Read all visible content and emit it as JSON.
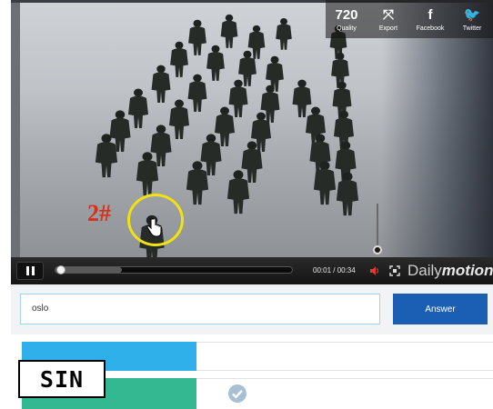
{
  "player": {
    "share": [
      {
        "glyph": "720",
        "label": "Quality",
        "icon": "quality-icon"
      },
      {
        "glyph": "⤧",
        "label": "Export",
        "icon": "export-icon"
      },
      {
        "glyph": "f",
        "label": "Facebook",
        "icon": "facebook-icon"
      },
      {
        "glyph": "🐦",
        "label": "Twitter",
        "icon": "twitter-icon"
      }
    ],
    "time": "00:01 / 00:34",
    "brand_light": "Daily",
    "brand_bold": "motion",
    "progress_fraction": 0.0,
    "buffered_fraction": 0.28,
    "volume_fraction": 0.0
  },
  "annotation": "2#",
  "quiz": {
    "answer_value": "oslo",
    "answer_button": "Answer"
  },
  "badge": "SIN",
  "colors": {
    "answer_button": "#1a5fb4",
    "bar_blue": "#2fb0ea",
    "bar_green": "#34b892",
    "highlight": "#f2e20d",
    "annotation": "#d92f1b"
  }
}
